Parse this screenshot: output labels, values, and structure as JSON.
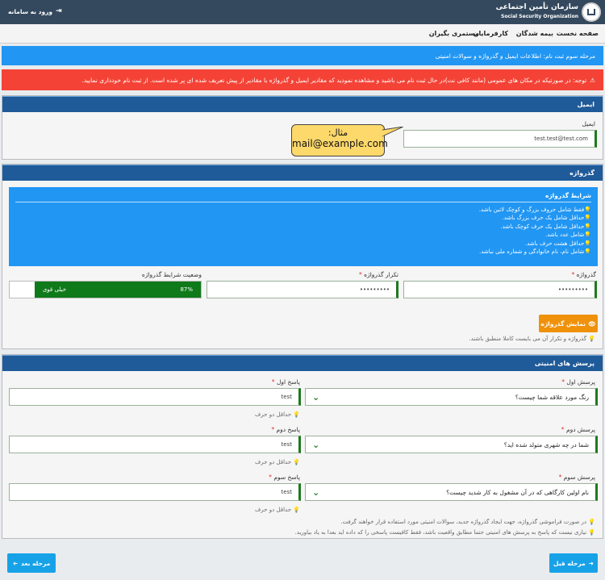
{
  "header": {
    "login_label": "ورود به سامانه",
    "org_name": "سازمان تأمین اجتماعی",
    "org_name_en": "Social Security Organization"
  },
  "nav": {
    "home": "صفحه نخست",
    "insured": "بیمه شدگان",
    "employers": "کارفرمایان",
    "pensioners": "مستمری بگیران"
  },
  "step_banner": "مرحله سوم ثبت نام: اطلاعات ایمیل و گذرواژه و سوالات امنیتی",
  "warning": "توجه: در صورتیکه در مکان های عمومی (مانند کافی نت)در حال ثبت نام می باشید و مشاهده نمودید که مقادیر ایمیل و گذرواژه با مقادیر از پیش تعریف شده ای پر شده است. از ثبت نام خودداری نمایید.",
  "email": {
    "section_title": "ایمیل",
    "label": "ایمیل",
    "value": "test.test@test.com",
    "tooltip_title": "مثال:",
    "tooltip_example": "mail@example.com"
  },
  "password": {
    "section_title": "گذرواژه",
    "rules_title": "شرایط گذرواژه",
    "rules": [
      "فقط شامل حروف بزرگ و کوچک لاتین باشد.",
      "حداقل شامل یک حرف بزرگ باشد.",
      "حداقل شامل یک حرف کوچک باشد.",
      "شامل عدد باشد.",
      "حداقل هشت حرف باشد.",
      "شامل نام، نام خانوادگی و شماره ملی نباشد."
    ],
    "password_label": "گذرواژه",
    "password_value": "•••••••••",
    "repeat_label": "تکرار گذرواژه",
    "repeat_value": "•••••••••",
    "strength_label": "وضعیت شرایط گذرواژه",
    "strength_percent": 87,
    "strength_percent_text": "87%",
    "strength_text": "خیلی قوی",
    "show_button": "نمایش گذرواژه",
    "match_hint": "گذرواژه و تکرار آن می بایست کاملا منطبق باشند."
  },
  "security": {
    "section_title": "پرسش های امنیتی",
    "questions": [
      {
        "q_label": "پرسش اول",
        "q_value": "رنگ مورد علاقه شما چیست؟",
        "a_label": "پاسخ اول",
        "a_value": "test",
        "a_hint": "حداقل دو حرف"
      },
      {
        "q_label": "پرسش دوم",
        "q_value": "شما در چه شهری متولد شده اید؟",
        "a_label": "پاسخ دوم",
        "a_value": "test",
        "a_hint": "حداقل دو حرف"
      },
      {
        "q_label": "پرسش سوم",
        "q_value": "نام اولین کارگاهی که در آن مشغول به کار شدید چیست؟",
        "a_label": "پاسخ سوم",
        "a_value": "test",
        "a_hint": "حداقل دو حرف"
      }
    ],
    "note1": "در صورت فراموشی گذرواژه، جهت ایجاد گذرواژه جدید، سوالات امنیتی مورد استفاده قرار خواهند گرفت.",
    "note2": "نیازی نیست که پاسخ به پرسش های امنیتی حتما مطابق واقعیت باشد، فقط کافیست پاسخی را که داده اید بعدا به یاد بیاورید."
  },
  "footer": {
    "prev_label": "مرحله قبل",
    "next_label": "مرحله بعد"
  },
  "colors": {
    "header_bg": "#34495e",
    "banner_blue": "#2196f3",
    "warning_red": "#f44336",
    "panel_head": "#1f5a99",
    "strength_green": "#0f7a1a",
    "show_button_orange": "#f0910a",
    "nav_button_blue": "#17a2e8"
  }
}
